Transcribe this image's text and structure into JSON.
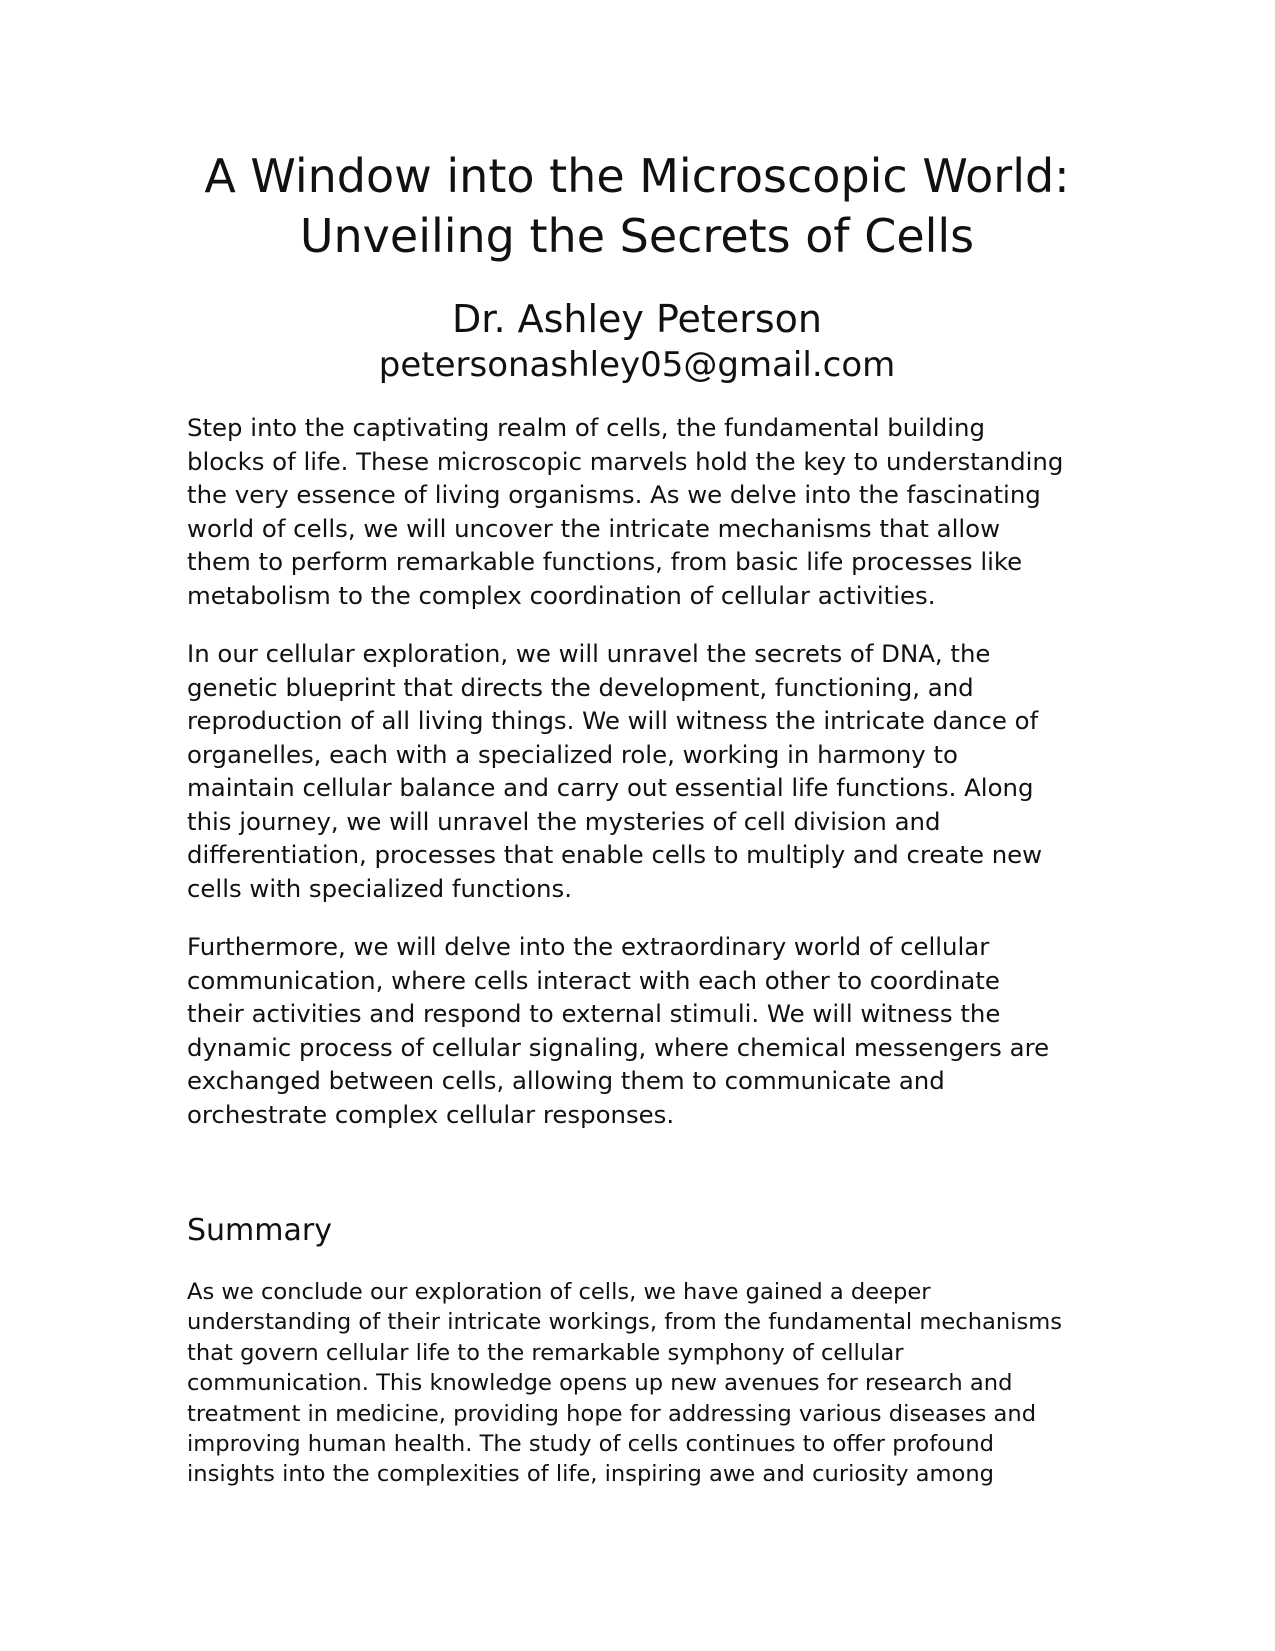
{
  "document": {
    "title_line1": "A Window into the Microscopic World:",
    "title_line2": "Unveiling the Secrets of Cells",
    "author": "Dr. Ashley Peterson",
    "email": "petersonashley05@gmail.com",
    "paragraphs": [
      "Step into the captivating realm of cells, the fundamental building\nblocks of life. These microscopic marvels hold the key to understanding\nthe very essence of living organisms. As we delve into the fascinating\nworld of cells, we will uncover the intricate mechanisms that allow\nthem to perform remarkable functions, from basic life processes like\nmetabolism to the complex coordination of cellular activities.",
      "In our cellular exploration, we will unravel the secrets of DNA, the\ngenetic blueprint that directs the development, functioning, and\nreproduction of all living things. We will witness the intricate dance of\norganelles, each with a specialized role, working in harmony to\nmaintain cellular balance and carry out essential life functions. Along\nthis journey, we will unravel the mysteries of cell division and\ndifferentiation, processes that enable cells to multiply and create new\ncells with specialized functions.",
      "Furthermore, we will delve into the extraordinary world of cellular\ncommunication, where cells interact with each other to coordinate\ntheir activities and respond to external stimuli. We will witness the\ndynamic process of cellular signaling, where chemical messengers are\nexchanged between cells, allowing them to communicate and\norchestrate complex cellular responses."
    ],
    "summary": {
      "heading": "Summary",
      "text": "As we conclude our exploration of cells, we have gained a deeper\nunderstanding of their intricate workings, from the fundamental mechanisms\nthat govern cellular life to the remarkable symphony of cellular\ncommunication. This knowledge opens up new avenues for research and\ntreatment in medicine, providing hope for addressing various diseases and\nimproving human health. The study of cells continues to offer profound\ninsights into the complexities of life, inspiring awe and curiosity among"
    }
  }
}
